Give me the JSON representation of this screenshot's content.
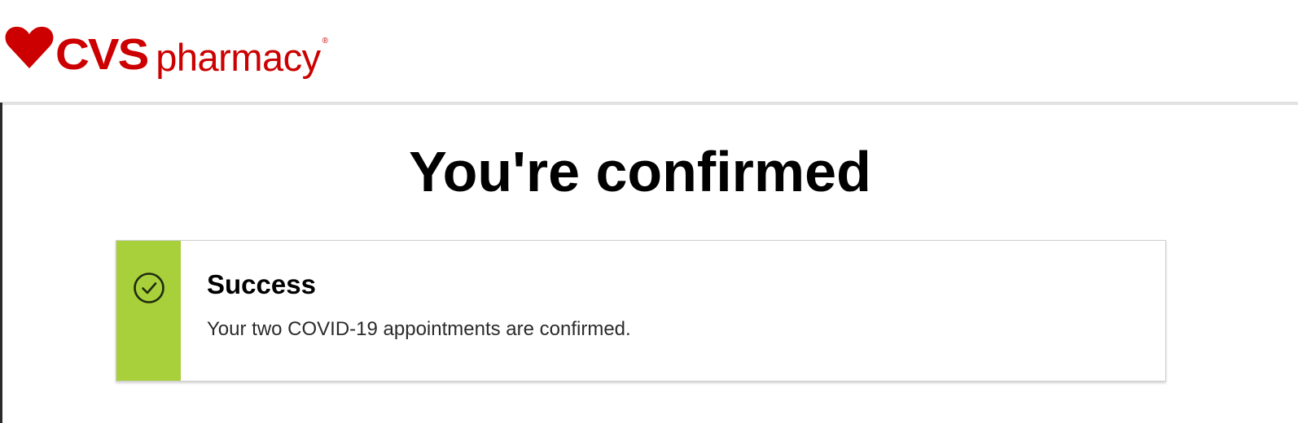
{
  "header": {
    "logo": {
      "brand": "CVS",
      "product": "pharmacy",
      "registered_mark": "®",
      "icon": "heart-logo-icon",
      "color": "#cc0000"
    }
  },
  "main": {
    "title": "You're confirmed",
    "alert": {
      "status": "success",
      "icon": "check-circle-icon",
      "accent_color": "#a8d03a",
      "title": "Success",
      "message": "Your two COVID-19 appointments are confirmed."
    }
  }
}
